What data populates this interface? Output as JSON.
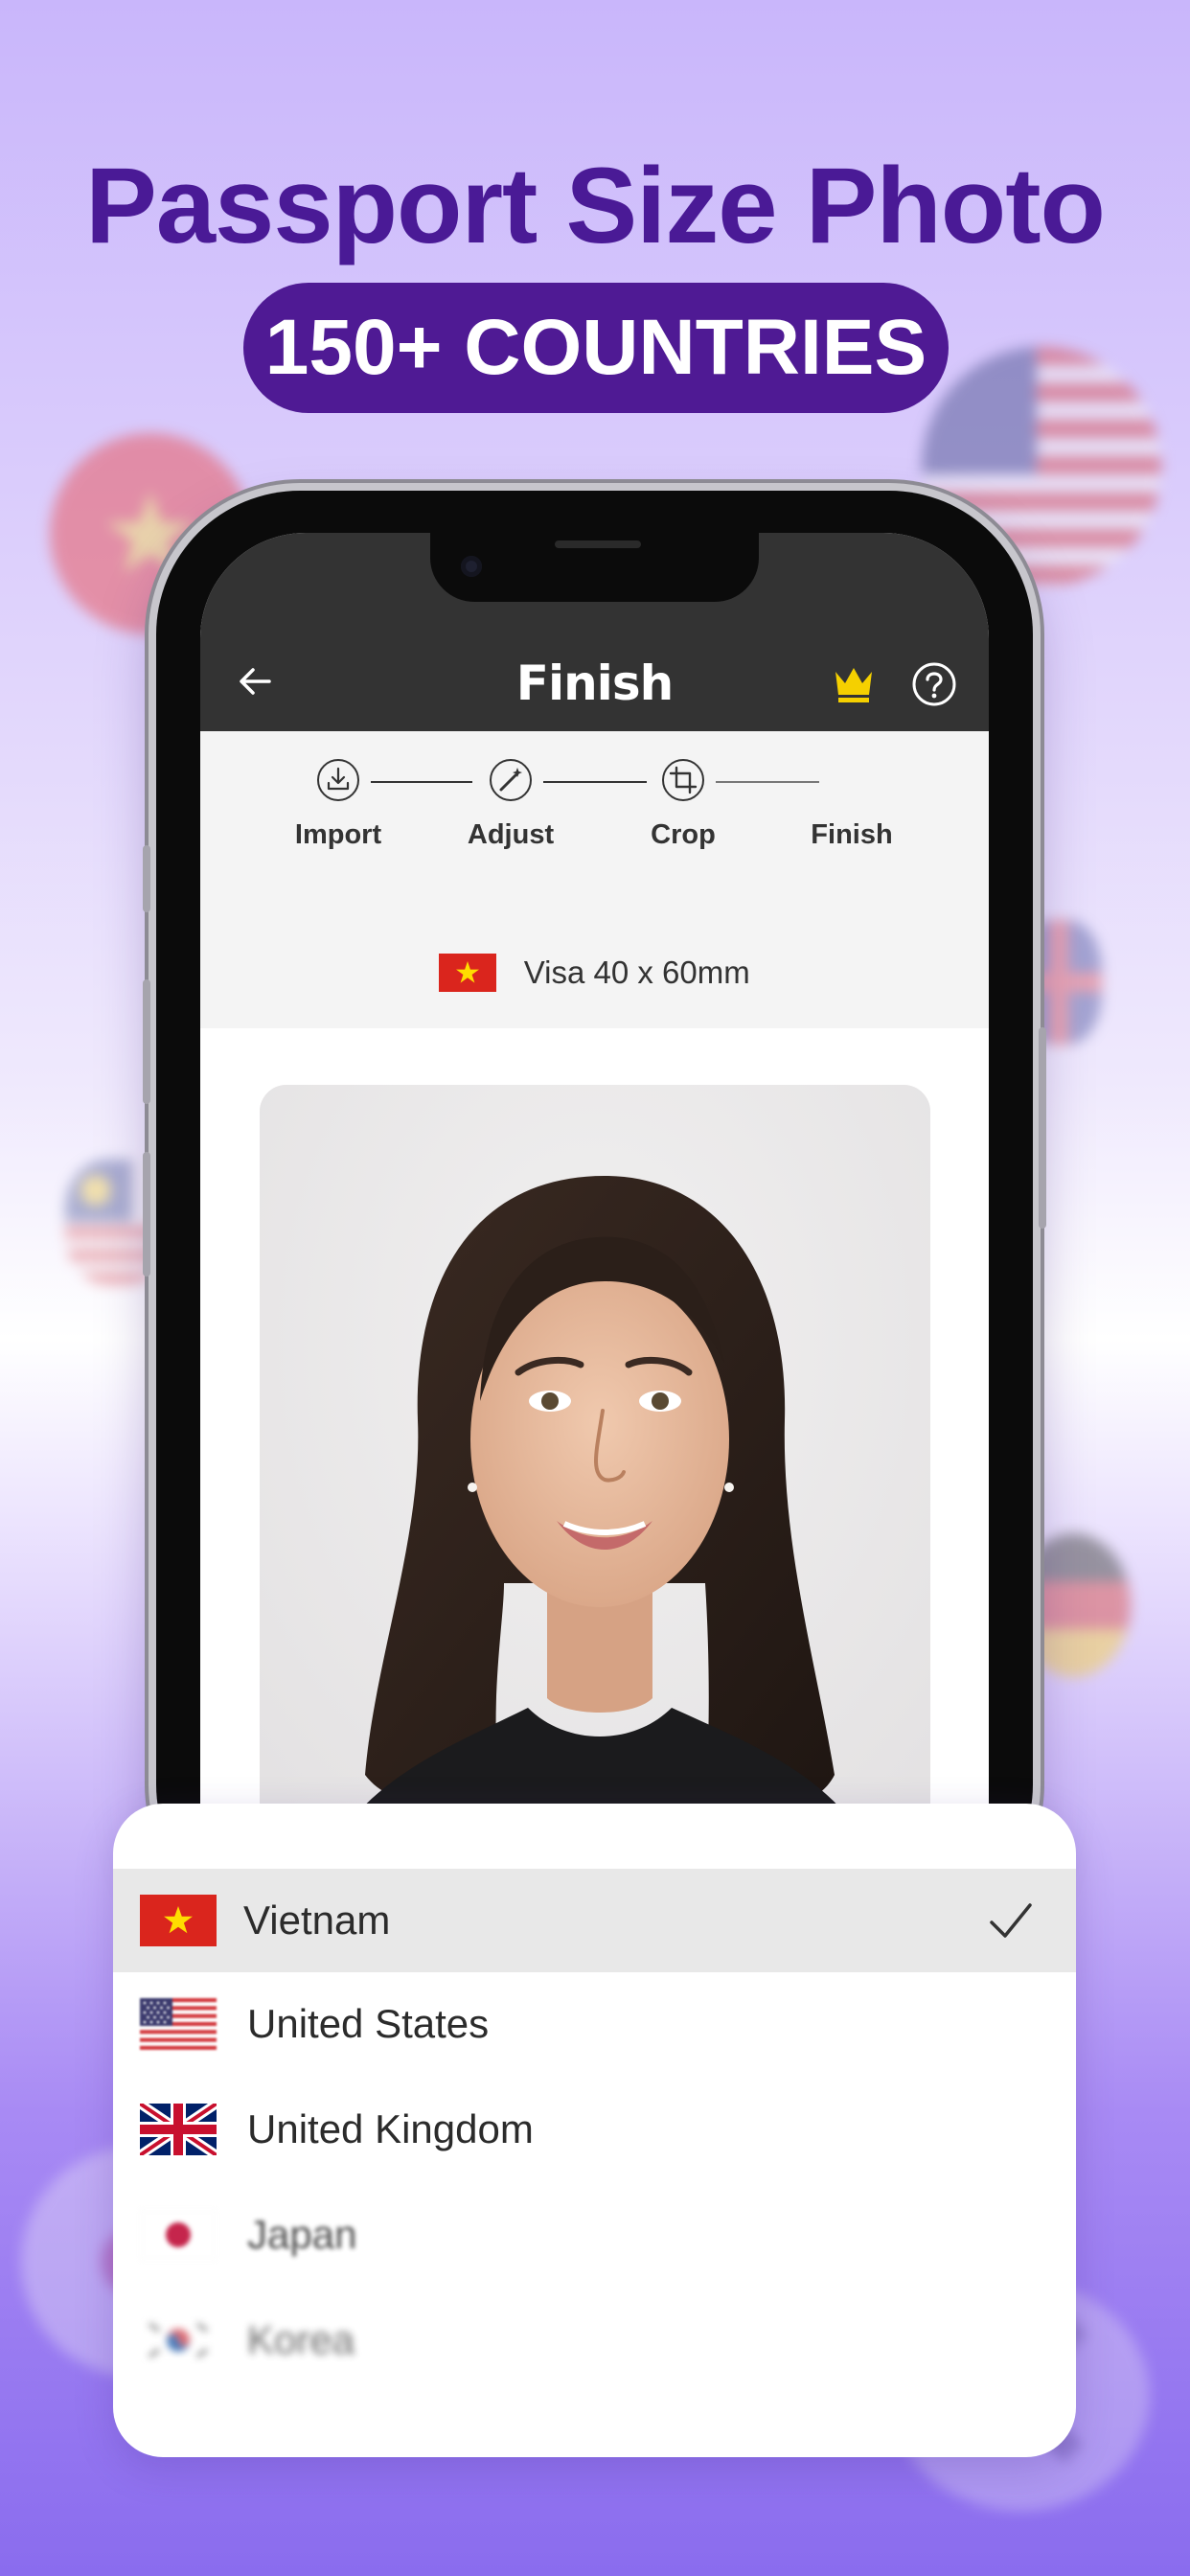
{
  "promo": {
    "headline": "Passport Size Photo",
    "badge": "150+ COUNTRIES"
  },
  "colors": {
    "headline": "#4a1a96",
    "badge_bg": "#4f1a94",
    "crown": "#f5d000",
    "topbar": "#333333"
  },
  "header": {
    "title": "Finish",
    "back_icon": "arrow-left-icon",
    "premium_icon": "crown-icon",
    "help_icon": "question-circle-icon"
  },
  "steps": [
    {
      "label": "Import",
      "icon": "import-icon"
    },
    {
      "label": "Adjust",
      "icon": "magic-wand-icon"
    },
    {
      "label": "Crop",
      "icon": "crop-icon"
    },
    {
      "label": "Finish",
      "icon": ""
    }
  ],
  "spec": {
    "label": "Visa 40 x 60mm",
    "flag": "vietnam-flag-icon"
  },
  "country_dropdown": {
    "selected": "Vietnam",
    "options": [
      {
        "label": "Vietnam",
        "flag": "vietnam-flag-icon"
      },
      {
        "label": "United States",
        "flag": "us-flag-icon"
      },
      {
        "label": "United Kingdom",
        "flag": "uk-flag-icon"
      },
      {
        "label": "Japan",
        "flag": "japan-flag-icon"
      },
      {
        "label": "Korea",
        "flag": "korea-flag-icon"
      }
    ]
  }
}
